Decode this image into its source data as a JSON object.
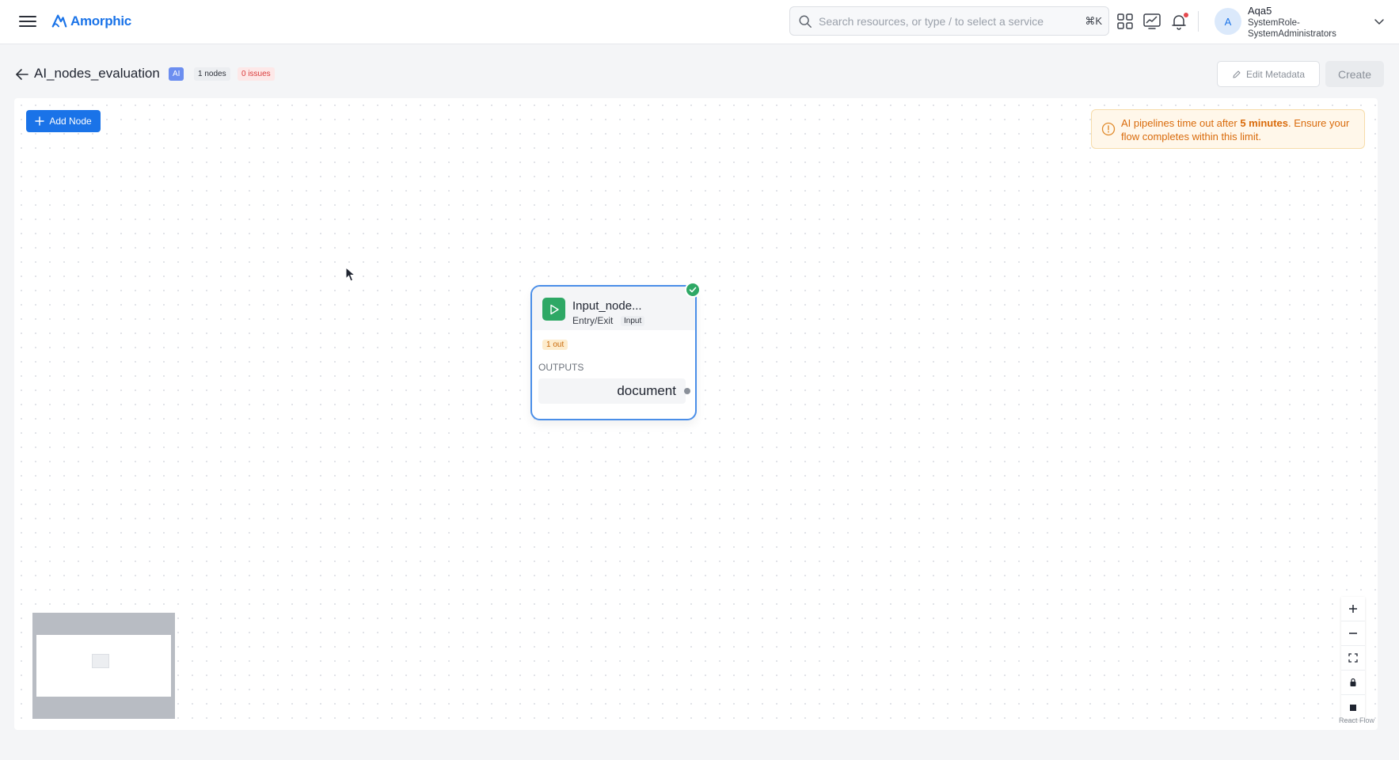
{
  "header": {
    "logo_text": "Amorphic",
    "search_placeholder": "Search resources, or type / to select a service",
    "search_shortcut": "⌘K",
    "user_initial": "A",
    "user_name": "Aqa5",
    "user_role": "SystemRole-SystemAdministrators",
    "icons": [
      "menu-icon",
      "apps-grid-icon",
      "monitoring-icon",
      "notification-bell-icon",
      "chevron-down-icon"
    ]
  },
  "page": {
    "title": "AI_nodes_evaluation",
    "type_badge": "AI",
    "nodes_badge": "1 nodes",
    "issues_badge": "0 issues",
    "edit_metadata_label": "Edit Metadata",
    "create_label": "Create"
  },
  "canvas": {
    "add_node_label": "Add Node",
    "alert": {
      "prefix": "AI pipelines time out after ",
      "emphasis": "5 minutes",
      "suffix": ". Ensure your flow completes within this limit."
    },
    "node": {
      "title": "Input_node...",
      "category": "Entry/Exit",
      "type_badge": "Input",
      "out_badge": "1 out",
      "outputs_label": "OUTPUTS",
      "output_name": "document",
      "status": "valid"
    },
    "attribution": "React Flow"
  },
  "colors": {
    "primary": "#1a73e8",
    "success": "#2ea865",
    "warning": "#d96b0c",
    "danger": "#d93b3b",
    "ai_badge": "#6c8ef0"
  }
}
